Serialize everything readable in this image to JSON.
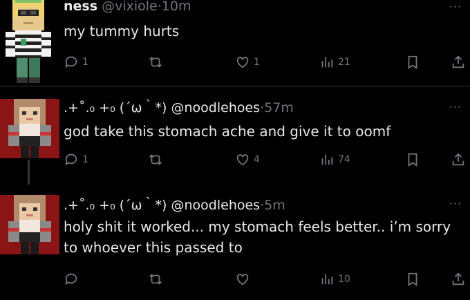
{
  "tweets": [
    {
      "name": "ness",
      "handle": "@vixiole",
      "dot": "·",
      "time": "10m",
      "more": "···",
      "text": "my tummy hurts",
      "avatar": "minecraft-skin-blond-striped",
      "counts": {
        "reply": "1",
        "retweet": "",
        "like": "1",
        "views": "21"
      }
    },
    {
      "name": "",
      "handle": ".+˚.₀ +₀ (´ω｀*) @noodlehoes",
      "dot": "·",
      "time": "57m",
      "more": "···",
      "text": "god take this stomach ache and give it to oomf",
      "avatar": "minecraft-skin-brown-hair",
      "counts": {
        "reply": "1",
        "retweet": "",
        "like": "4",
        "views": "74"
      }
    },
    {
      "name": "",
      "handle": ".+˚.₀ +₀ (´ω｀*) @noodlehoes",
      "dot": "·",
      "time": "5m",
      "more": "···",
      "text": "holy shit it worked... my stomach feels better.. i’m sorry to whoever this passed to",
      "avatar": "minecraft-skin-brown-hair",
      "counts": {
        "reply": "",
        "retweet": "",
        "like": "",
        "views": "10"
      }
    }
  ],
  "colors": {
    "background": "#000000",
    "text": "#e7e9ea",
    "muted": "#71767b",
    "divider": "#2f3336"
  }
}
